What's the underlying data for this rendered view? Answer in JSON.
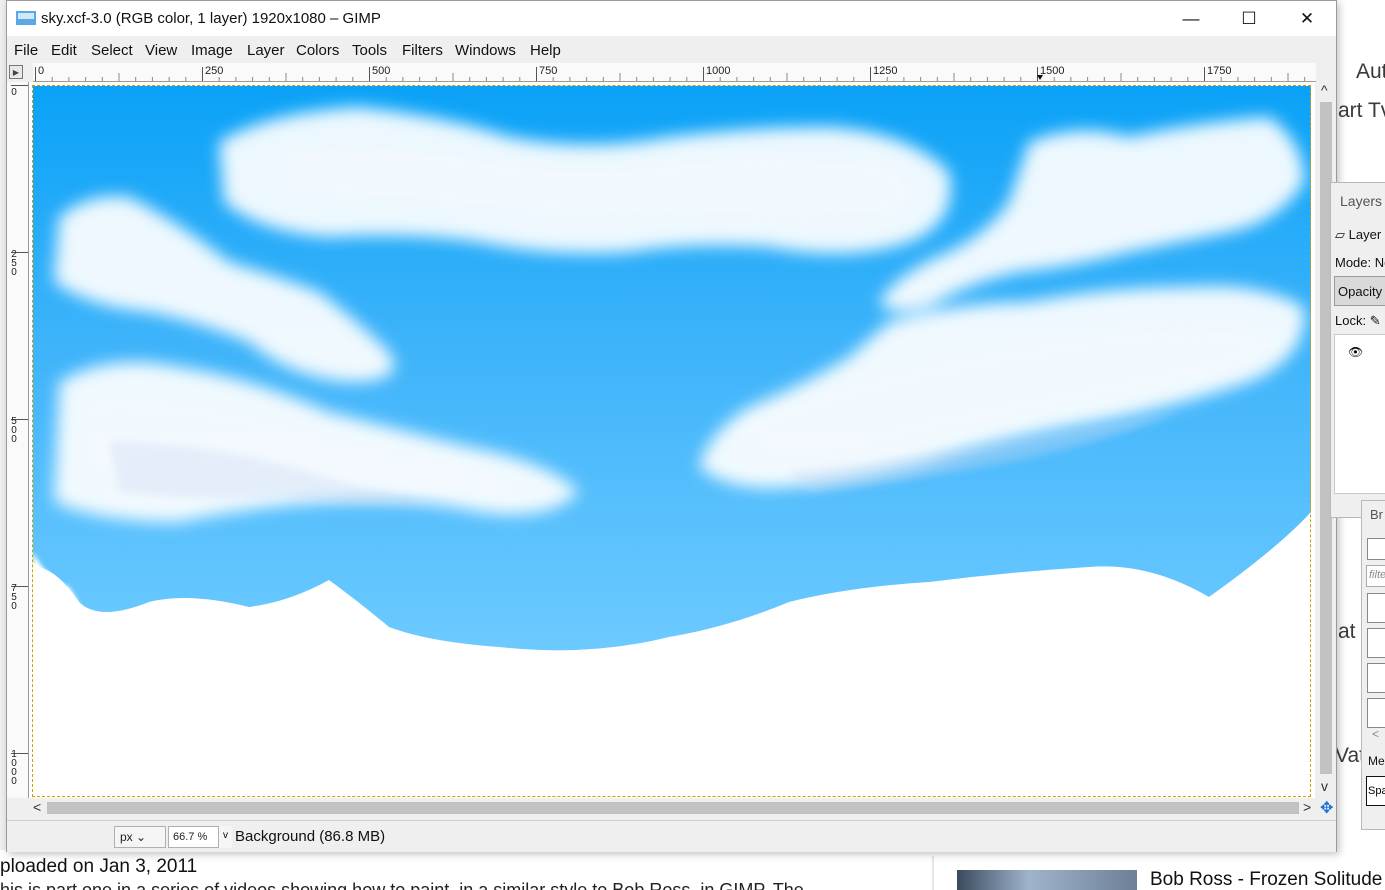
{
  "window": {
    "title": "sky.xcf-3.0 (RGB color, 1 layer) 1920x1080 – GIMP",
    "controls": {
      "minimize": "—",
      "maximize": "☐",
      "close": "✕"
    }
  },
  "menubar": [
    "File",
    "Edit",
    "Select",
    "View",
    "Image",
    "Layer",
    "Colors",
    "Tools",
    "Filters",
    "Windows",
    "Help"
  ],
  "rulers": {
    "horizontal": [
      "0",
      "250",
      "500",
      "750",
      "1000",
      "1250",
      "1500",
      "1750"
    ],
    "vertical": [
      "0",
      "250",
      "500",
      "750",
      "1000"
    ]
  },
  "statusbar": {
    "unit": "px",
    "zoom": "66.7 %",
    "info": "Background (86.8 MB)"
  },
  "layers_dock": {
    "tab": "Layers",
    "layer_item": "Layer",
    "mode_label": "Mode: Nc",
    "opacity_label": "Opacity",
    "lock_label": "Lock:"
  },
  "brushes_dock": {
    "tab": "Br",
    "filter_placeholder": "filte",
    "mode": "Me",
    "spacing": "Spa"
  },
  "background_page": {
    "right_text": [
      "Aut",
      "art Tv",
      "at",
      "Vate"
    ],
    "upload_date": "ploaded on Jan 3, 2011",
    "description": "his is part one in a series of videos showing how to paint, in a similar style to Bob Ross, in GIMP. The",
    "video_title": "Bob Ross - Frozen Solitude"
  }
}
